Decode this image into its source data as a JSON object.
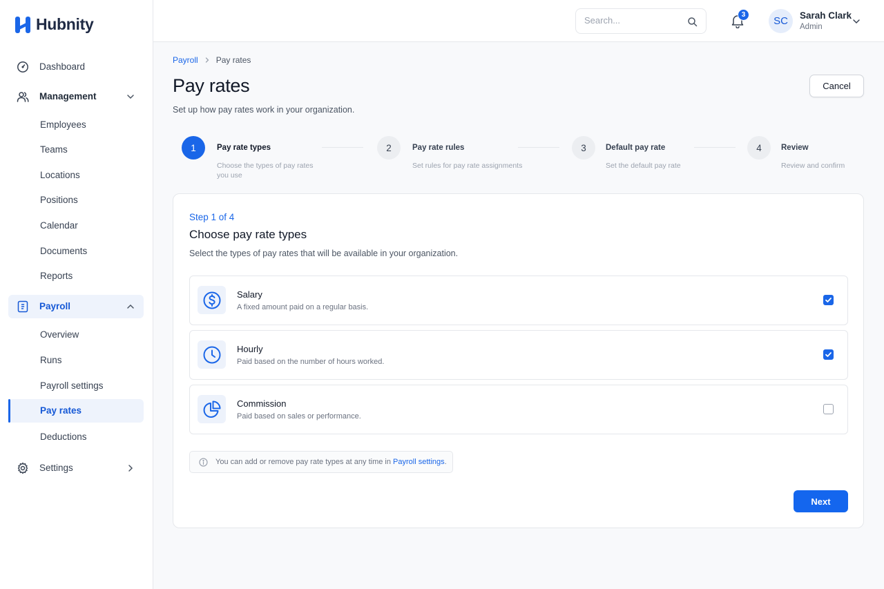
{
  "app": {
    "name": "Hubnity",
    "accent_color": "#1a66e8"
  },
  "sidebar": {
    "dashboard": {
      "label": "Dashboard",
      "icon": "gauge-icon"
    },
    "management": {
      "label": "Management",
      "icon": "users-icon",
      "expanded": true,
      "items": [
        {
          "label": "Employees"
        },
        {
          "label": "Teams"
        },
        {
          "label": "Locations"
        },
        {
          "label": "Positions"
        },
        {
          "label": "Calendar"
        },
        {
          "label": "Documents"
        },
        {
          "label": "Reports"
        }
      ]
    },
    "payroll": {
      "label": "Payroll",
      "icon": "payroll-icon",
      "expanded": true,
      "items": [
        {
          "label": "Overview"
        },
        {
          "label": "Runs"
        },
        {
          "label": "Payroll settings"
        },
        {
          "label": "Pay rates",
          "active": true
        },
        {
          "label": "Deductions"
        }
      ]
    },
    "settings": {
      "label": "Settings",
      "icon": "gear-icon"
    }
  },
  "header": {
    "search_placeholder": "Search...",
    "notifications_count": "3",
    "user": {
      "initials": "SC",
      "name": "Sarah Clark",
      "role": "Admin"
    }
  },
  "breadcrumb": {
    "parent": "Payroll",
    "current": "Pay rates"
  },
  "page": {
    "title": "Pay rates",
    "subtitle": "Set up how pay rates work in your organization.",
    "cancel_label": "Cancel"
  },
  "stepper": [
    {
      "number": "1",
      "title": "Pay rate types",
      "description": "Choose the types of pay rates you use",
      "active": true
    },
    {
      "number": "2",
      "title": "Pay rate rules",
      "description": "Set rules for pay rate assignments",
      "active": false
    },
    {
      "number": "3",
      "title": "Default pay rate",
      "description": "Set the default pay rate",
      "active": false
    },
    {
      "number": "4",
      "title": "Review",
      "description": "Review and confirm",
      "active": false
    }
  ],
  "card": {
    "step_label": "Step 1 of 4",
    "title": "Choose pay rate types",
    "description": "Select the types of pay rates that will be available in your organization.",
    "options": [
      {
        "name": "Salary",
        "description": "A fixed amount paid on a regular basis.",
        "icon": "dollar-circle-icon",
        "checked": true
      },
      {
        "name": "Hourly",
        "description": "Paid based on the number of hours worked.",
        "icon": "clock-icon",
        "checked": true
      },
      {
        "name": "Commission",
        "description": "Paid based on sales or performance.",
        "icon": "pie-chart-icon",
        "checked": false
      }
    ],
    "info": {
      "text": "You can add or remove pay rate types at any time in ",
      "link": "Payroll settings",
      "suffix": "."
    },
    "next_label": "Next"
  }
}
